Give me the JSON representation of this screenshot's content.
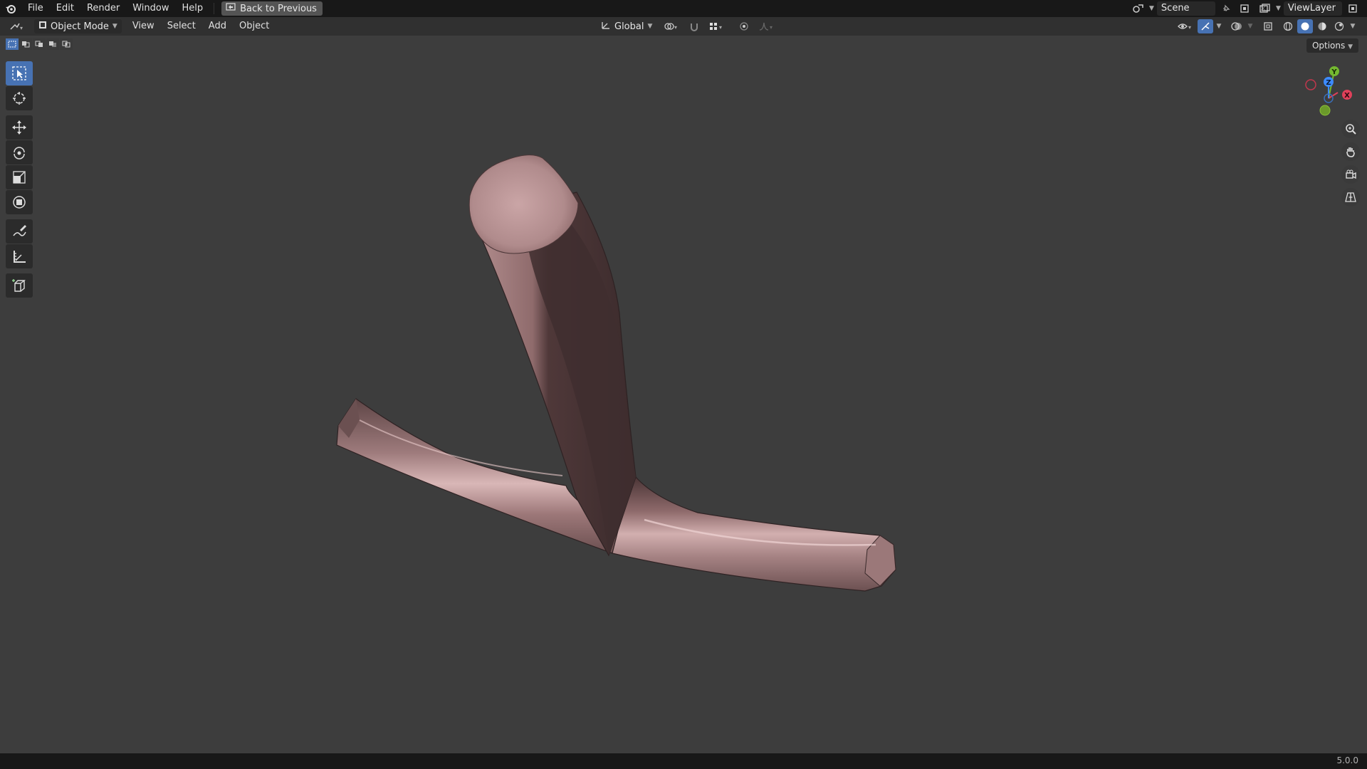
{
  "menu": {
    "items": [
      "File",
      "Edit",
      "Render",
      "Window",
      "Help"
    ],
    "back_button": "Back to Previous"
  },
  "scene": {
    "label": "Scene"
  },
  "view_layer": {
    "label": "ViewLayer"
  },
  "header": {
    "mode": "Object Mode",
    "menus": [
      "View",
      "Select",
      "Add",
      "Object"
    ],
    "orientation": "Global"
  },
  "viewport": {
    "options_label": "Options",
    "object_color": "#a07f80",
    "gizmo_axes": {
      "x": "X",
      "y": "Y",
      "z": "Z"
    }
  },
  "toolbar": {
    "tools": [
      "select-box",
      "cursor",
      "move",
      "rotate",
      "scale",
      "transform",
      "annotate",
      "measure",
      "add-cube"
    ],
    "active": "select-box"
  },
  "status": {
    "version": "5.0.0"
  }
}
